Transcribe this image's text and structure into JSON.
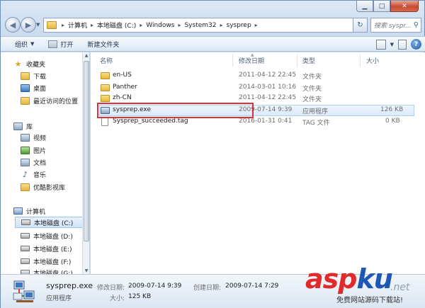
{
  "window": {
    "caption": {
      "minimize": "▁",
      "maximize": "□",
      "close": "✕"
    }
  },
  "address": {
    "crumbs": [
      "计算机",
      "本地磁盘 (C:)",
      "Windows",
      "System32",
      "sysprep"
    ],
    "search_placeholder": "搜索 syspr...",
    "refresh": "↻"
  },
  "toolbar": {
    "organize": "组织",
    "open": "打开",
    "new_folder": "新建文件夹"
  },
  "nav": {
    "favorites": "收藏夹",
    "downloads": "下载",
    "desktop": "桌面",
    "recent": "最近访问的位置",
    "libraries": "库",
    "videos": "视频",
    "pictures": "图片",
    "documents": "文档",
    "music": "音乐",
    "youku": "优酷影视库",
    "computer": "计算机",
    "drives": [
      "本地磁盘 (C:)",
      "本地磁盘 (D:)",
      "本地磁盘 (E:)",
      "本地磁盘 (F:)",
      "本地磁盘 (G:)"
    ]
  },
  "columns": {
    "name": "名称",
    "modified": "修改日期",
    "type": "类型",
    "size": "大小"
  },
  "files": [
    {
      "name": "en-US",
      "modified": "2011-04-12 22:45",
      "type": "文件夹",
      "size": ""
    },
    {
      "name": "Panther",
      "modified": "2014-03-01 10:16",
      "type": "文件夹",
      "size": ""
    },
    {
      "name": "zh-CN",
      "modified": "2011-04-12 22:45",
      "type": "文件夹",
      "size": ""
    },
    {
      "name": "sysprep.exe",
      "modified": "2009-07-14 9:39",
      "type": "应用程序",
      "size": "126 KB"
    },
    {
      "name": "Sysprep_succeeded.tag",
      "modified": "2016-01-31 0:41",
      "type": "TAG 文件",
      "size": "0 KB"
    }
  ],
  "details": {
    "name": "sysprep.exe",
    "type": "应用程序",
    "modified_label": "修改日期:",
    "modified_value": "2009-07-14 9:39",
    "created_label": "创建日期:",
    "created_value": "2009-07-14 7:29",
    "size_label": "大小:",
    "size_value": "125 KB"
  },
  "watermark": {
    "asp": "asp",
    "ku": "ku",
    "net": ".net",
    "sub": "免费网站源码下载站!"
  },
  "colors": {
    "highlight": "#e0303a",
    "watermark_red": "#e12a2a",
    "watermark_blue": "#1f57b4"
  }
}
